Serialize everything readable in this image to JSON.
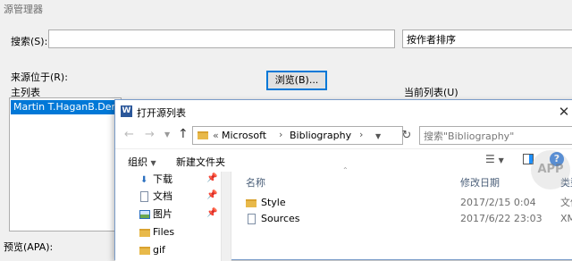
{
  "main_window": {
    "title": "源管理器",
    "search_label": "搜索(S):",
    "search_value": "",
    "sort_value": "按作者排序",
    "source_location_label": "来源位于(R):",
    "browse_button": "浏览(B)...",
    "master_list_label": "主列表",
    "master_list_items": [
      "Martin T.HaganB.Demuth"
    ],
    "current_list_label": "当前列表(U)",
    "preview_label": "预览(APA):"
  },
  "dialog": {
    "title": "打开源列表",
    "path_prefix": "«",
    "breadcrumb": [
      "Microsoft",
      "Bibliography"
    ],
    "search_placeholder": "搜索\"Bibliography\"",
    "toolbar": {
      "organize": "组织",
      "new_folder": "新建文件夹"
    },
    "nav_items": [
      {
        "label": "下载",
        "icon": "download-icon",
        "pinned": true
      },
      {
        "label": "文档",
        "icon": "document-icon",
        "pinned": true
      },
      {
        "label": "图片",
        "icon": "picture-icon",
        "pinned": true
      },
      {
        "label": "Files",
        "icon": "folder-icon",
        "pinned": false
      },
      {
        "label": "gif",
        "icon": "folder-icon",
        "pinned": false
      }
    ],
    "columns": {
      "name": "名称",
      "modified": "修改日期",
      "type": "类型"
    },
    "files": [
      {
        "name": "Style",
        "icon": "folder-icon",
        "modified": "2017/2/15 0:04",
        "type": "文件"
      },
      {
        "name": "Sources",
        "icon": "document-icon",
        "modified": "2017/6/22 23:03",
        "type": "XM"
      }
    ]
  },
  "watermark": "APP"
}
